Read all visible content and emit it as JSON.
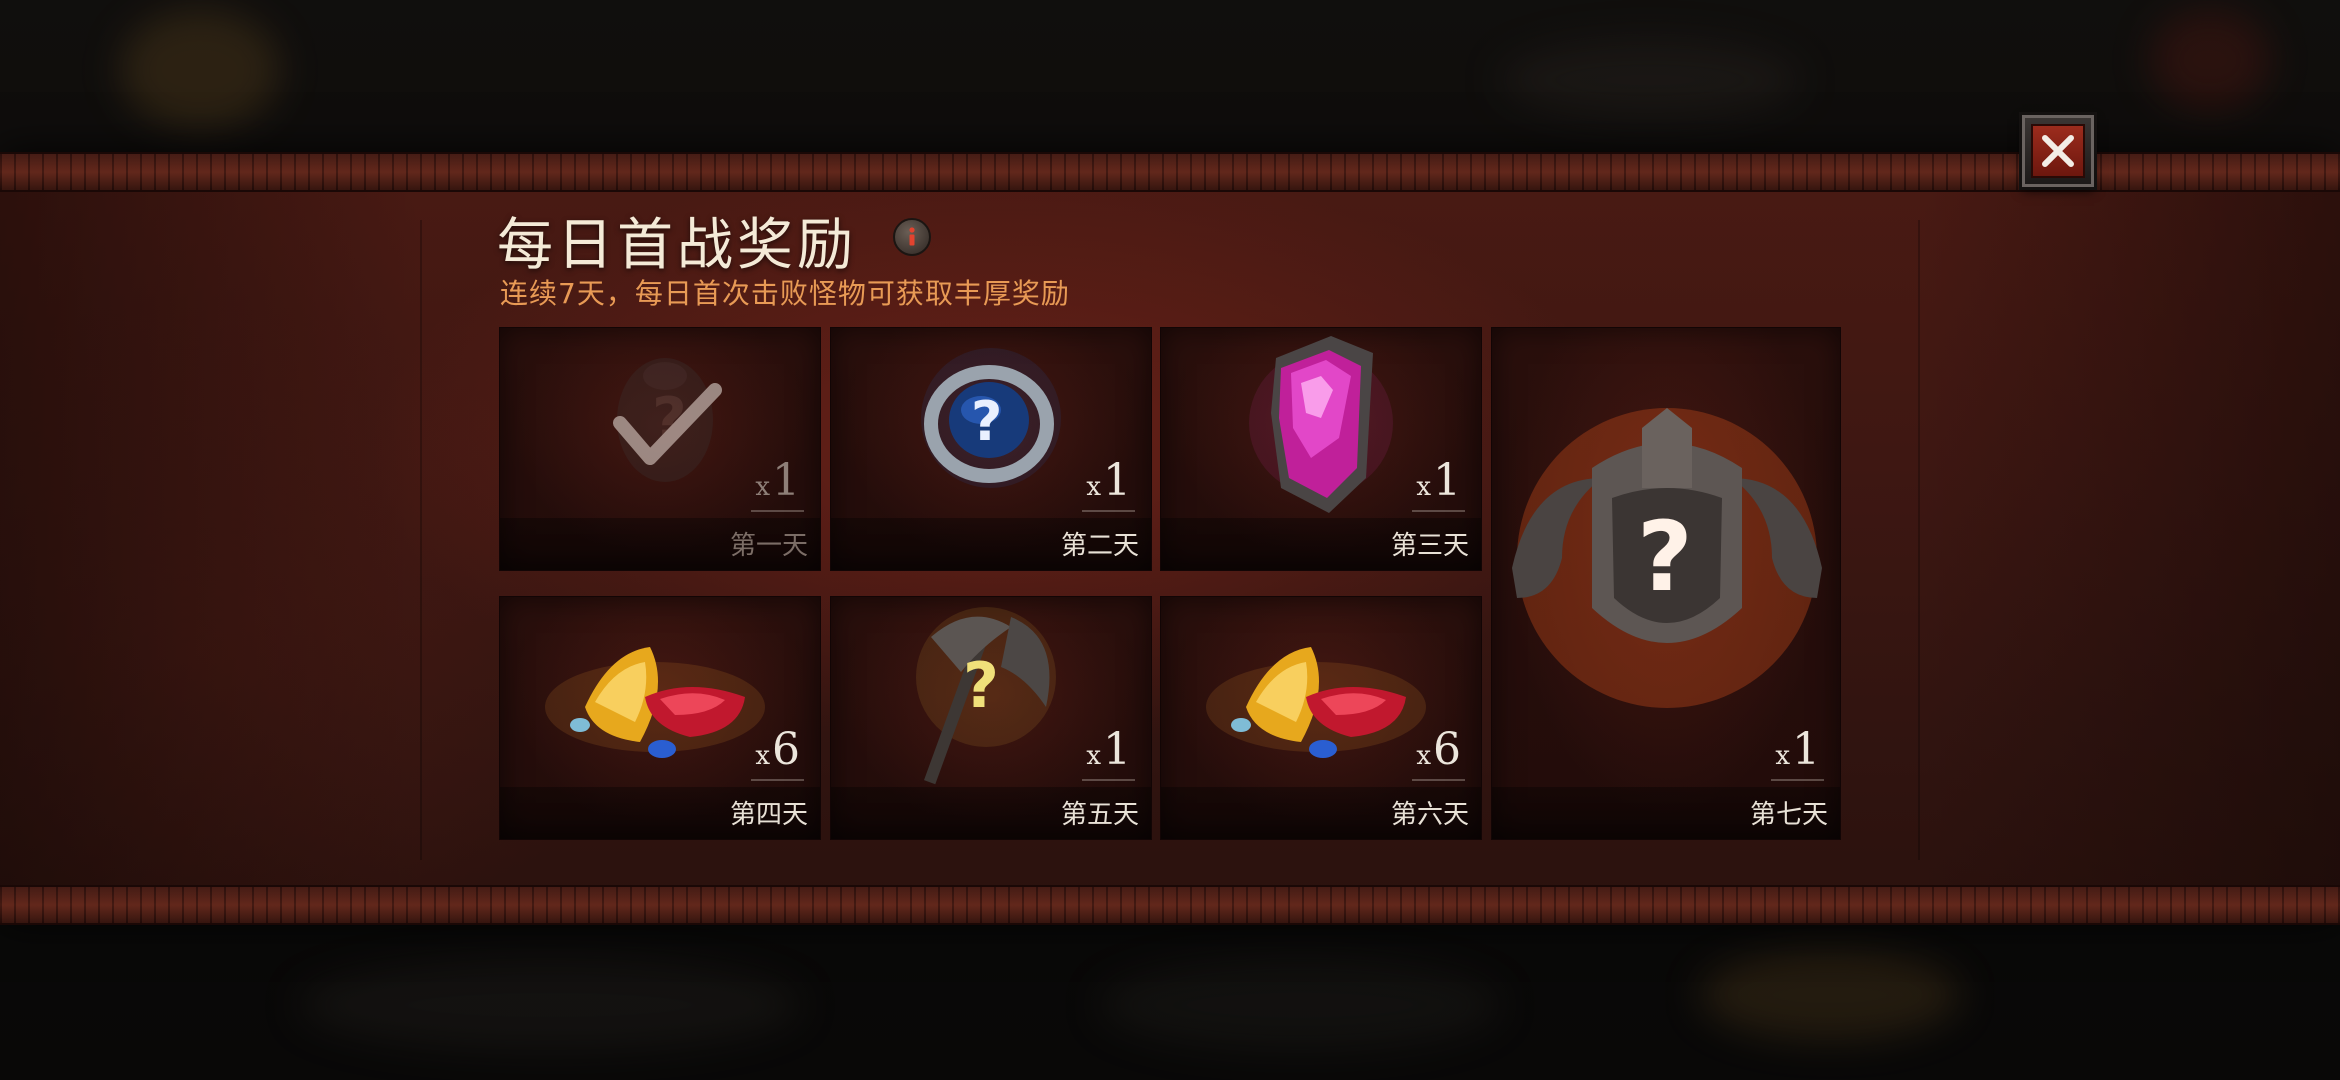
{
  "dialog": {
    "title": "每日首战奖励",
    "subtitle": "连续7天，每日首次击败怪物可获取丰厚奖励",
    "close_icon": "close-icon",
    "info_icon": "info-icon"
  },
  "rewards": [
    {
      "day": "第一天",
      "qty_prefix": "x",
      "qty": "1",
      "item": "mystery-amulet",
      "status": "claimed"
    },
    {
      "day": "第二天",
      "qty_prefix": "x",
      "qty": "1",
      "item": "mystery-ring",
      "status": "available"
    },
    {
      "day": "第三天",
      "qty_prefix": "x",
      "qty": "1",
      "item": "purple-crystal",
      "status": "available"
    },
    {
      "day": "第四天",
      "qty_prefix": "x",
      "qty": "6",
      "item": "gems",
      "status": "available"
    },
    {
      "day": "第五天",
      "qty_prefix": "x",
      "qty": "1",
      "item": "mystery-axe",
      "status": "available"
    },
    {
      "day": "第六天",
      "qty_prefix": "x",
      "qty": "6",
      "item": "gems",
      "status": "available"
    },
    {
      "day": "第七天",
      "qty_prefix": "x",
      "qty": "1",
      "item": "mystery-helmet",
      "status": "available"
    }
  ],
  "colors": {
    "title": "#f4ead7",
    "subtitle": "#e89a55",
    "panel": "#3e1712",
    "close_button": "#8c2518"
  }
}
